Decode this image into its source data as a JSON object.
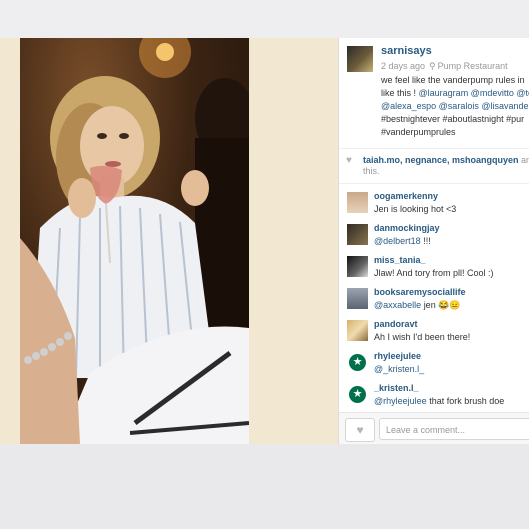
{
  "post": {
    "username": "sarnisays",
    "time": "2 days ago",
    "location": "Pump Restaurant",
    "caption_lines": [
      "we feel like the vanderpump rules in",
      "like this !",
      "@alexa_espo @saralois @lisavanderp",
      "#bestnightever #aboutlastnight #pur",
      "#vanderpumprules"
    ],
    "caption_mentions_line2": "@lauragram @mdevitto @tc"
  },
  "likes": {
    "names": "taiah.mo, negnance, mshoangquyen",
    "names_suffix": "and",
    "more": "this."
  },
  "comments": [
    {
      "user": "oogamerkenny",
      "text": "Jen is looking hot <3",
      "mention": "",
      "avatar": "face-avatar"
    },
    {
      "user": "danmockingjay",
      "text": "!!!",
      "mention": "@delbert18",
      "avatar": "portrait-avatar"
    },
    {
      "user": "miss_tania_",
      "text": "Jlaw! And tory from pll! Cool :)",
      "mention": "",
      "avatar": "bw-avatar"
    },
    {
      "user": "booksaremysociallife",
      "text": "jen 😂😑",
      "mention": "@axxabelle",
      "avatar": "landscape-avatar"
    },
    {
      "user": "pandoravt",
      "text": "Ah I wish I'd been there!",
      "mention": "",
      "avatar": "blonde-avatar"
    },
    {
      "user": "rhyleejulee",
      "text": "",
      "mention": "@_kristen.l_",
      "avatar": "starbucks-icon"
    },
    {
      "user": "_kristen.l_",
      "text": "that fork brush doe",
      "mention": "@rhyleejulee",
      "avatar": "starbucks-icon"
    }
  ],
  "footer": {
    "comment_placeholder": "Leave a comment..."
  },
  "colors": {
    "link": "#2a5b83",
    "media_bg": "#f2e8d2"
  }
}
